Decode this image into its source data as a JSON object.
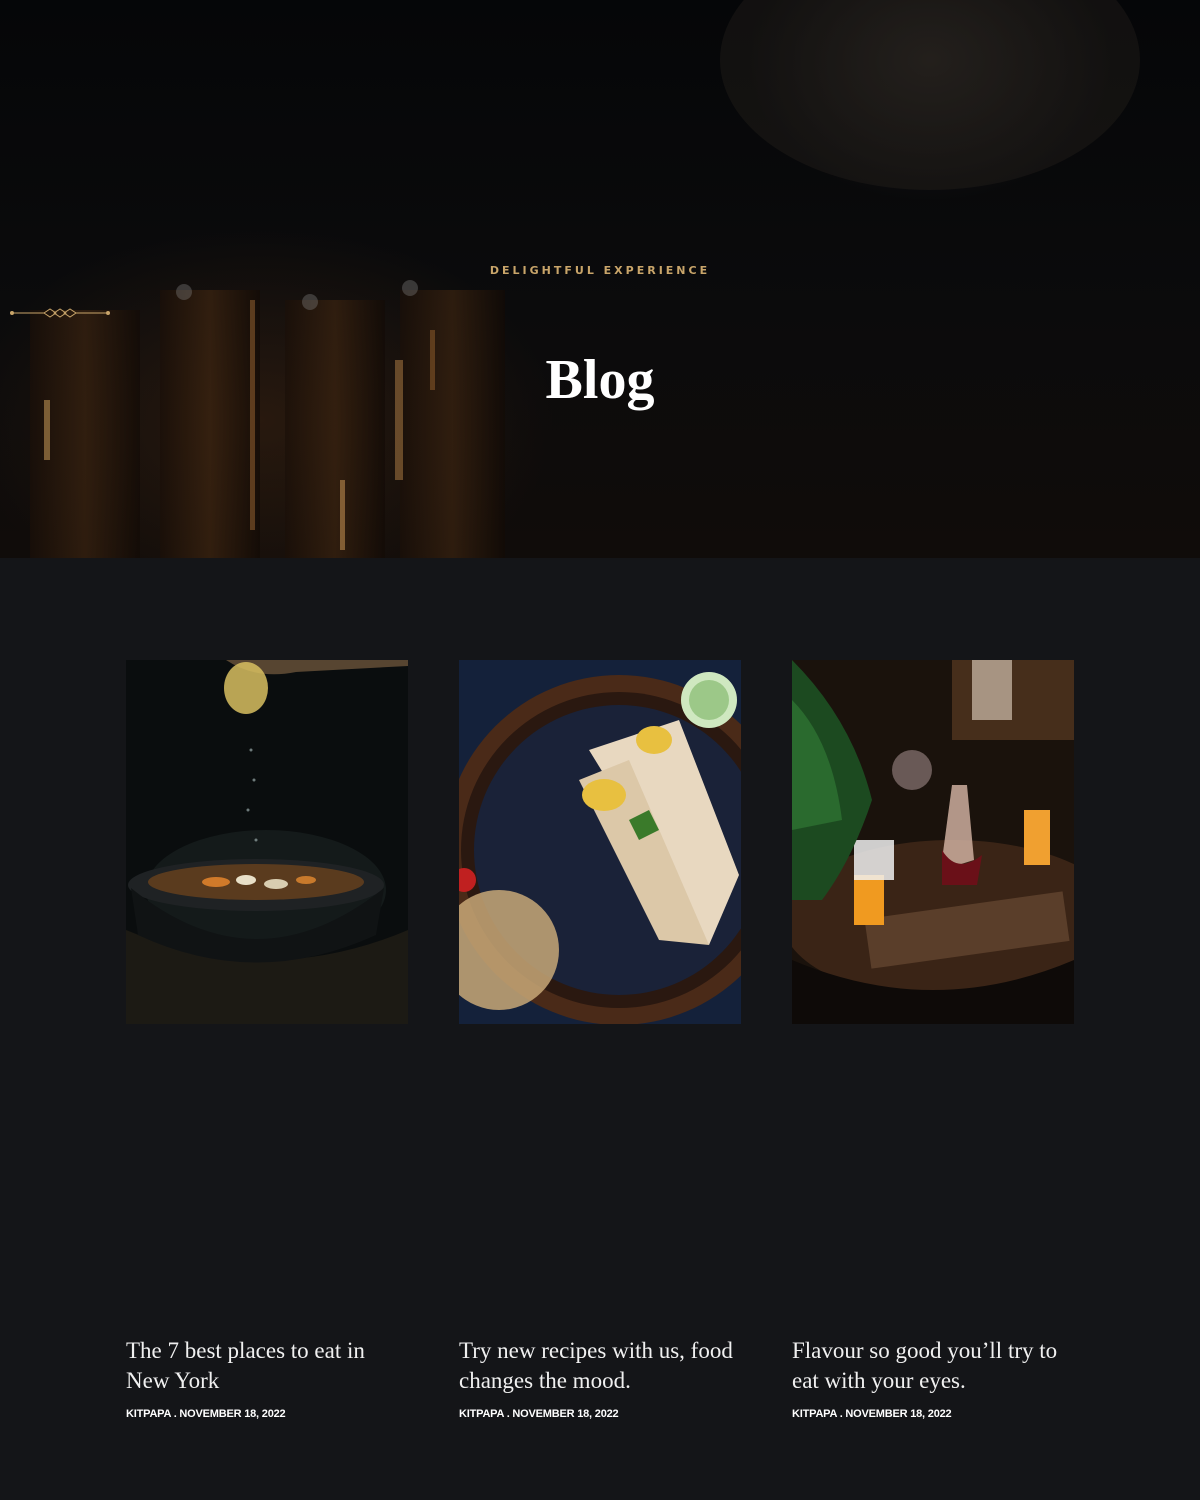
{
  "hero": {
    "eyebrow": "DELIGHTFUL EXPERIENCE",
    "title": "Blog"
  },
  "colors": {
    "accent": "#c9a56a",
    "background": "#141518",
    "hero_background": "#050608"
  },
  "posts": [
    {
      "title": "The 7 best places to eat in New York",
      "meta": "KITPAPA . NOVEMBER 18, 2022",
      "image": "soup-bowl-lemon-squeeze-photo"
    },
    {
      "title": "Try new recipes with us, food changes the mood.",
      "meta": "KITPAPA . NOVEMBER 18, 2022",
      "image": "wraps-on-plate-photo"
    },
    {
      "title": "Flavour so good you’ll try to eat with your eyes.",
      "meta": "KITPAPA . NOVEMBER 18, 2022",
      "image": "restaurant-table-drinks-photo"
    }
  ]
}
